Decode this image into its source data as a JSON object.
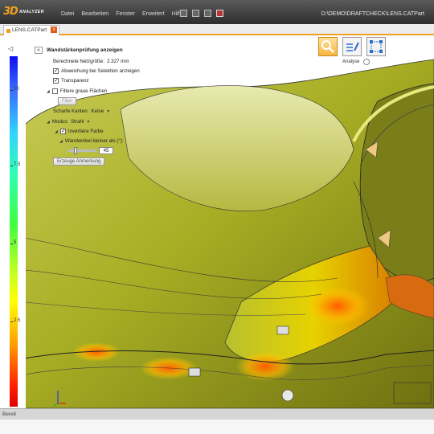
{
  "app": {
    "logo_main": "3D",
    "logo_sub": "ANALYZER",
    "menu": [
      "Datei",
      "Bearbeiten",
      "Fenster",
      "Erweitert",
      "Hilfe"
    ],
    "file_path": "D:\\DEMO\\DRAFTCHECK\\LENS.CATPart",
    "toolbar_icons": [
      "tool-icon",
      "open-icon",
      "save-icon",
      "export-icon"
    ],
    "accent_color": "#f0a020"
  },
  "tab": {
    "label": "LENS.CATPart",
    "close": "x"
  },
  "ribbon": {
    "label": "Analyse",
    "buttons": [
      "magnifier-icon",
      "edit-list-icon",
      "select-icon"
    ]
  },
  "scale": {
    "ticks": [
      "10",
      "7.5",
      "5",
      "2.5"
    ]
  },
  "panel": {
    "collapse": "«",
    "title": "Wandstärkenprüfung anzeigen",
    "mesh_label": "Berechnete Netzgröße:",
    "mesh_value": "2.327 mm",
    "show_deviation": "Abweichung bei Selektion anzeigen",
    "transparency": "Transparenz",
    "filter_grey": "Filtere graue Flächen",
    "filter_button": "Filter",
    "sharp_edges_label": "Scharfe Kanten:",
    "sharp_edges_value": "Keine",
    "mode_label": "Modus:",
    "mode_value": "Strahl",
    "invert_color": "Invertiere Farbe",
    "wall_angle_label": "Wandwinkel kleiner als (°):",
    "wall_angle_value": "45",
    "create_annotation": "Erzeuge Anmerkung"
  },
  "status": {
    "text": "Bereit"
  }
}
